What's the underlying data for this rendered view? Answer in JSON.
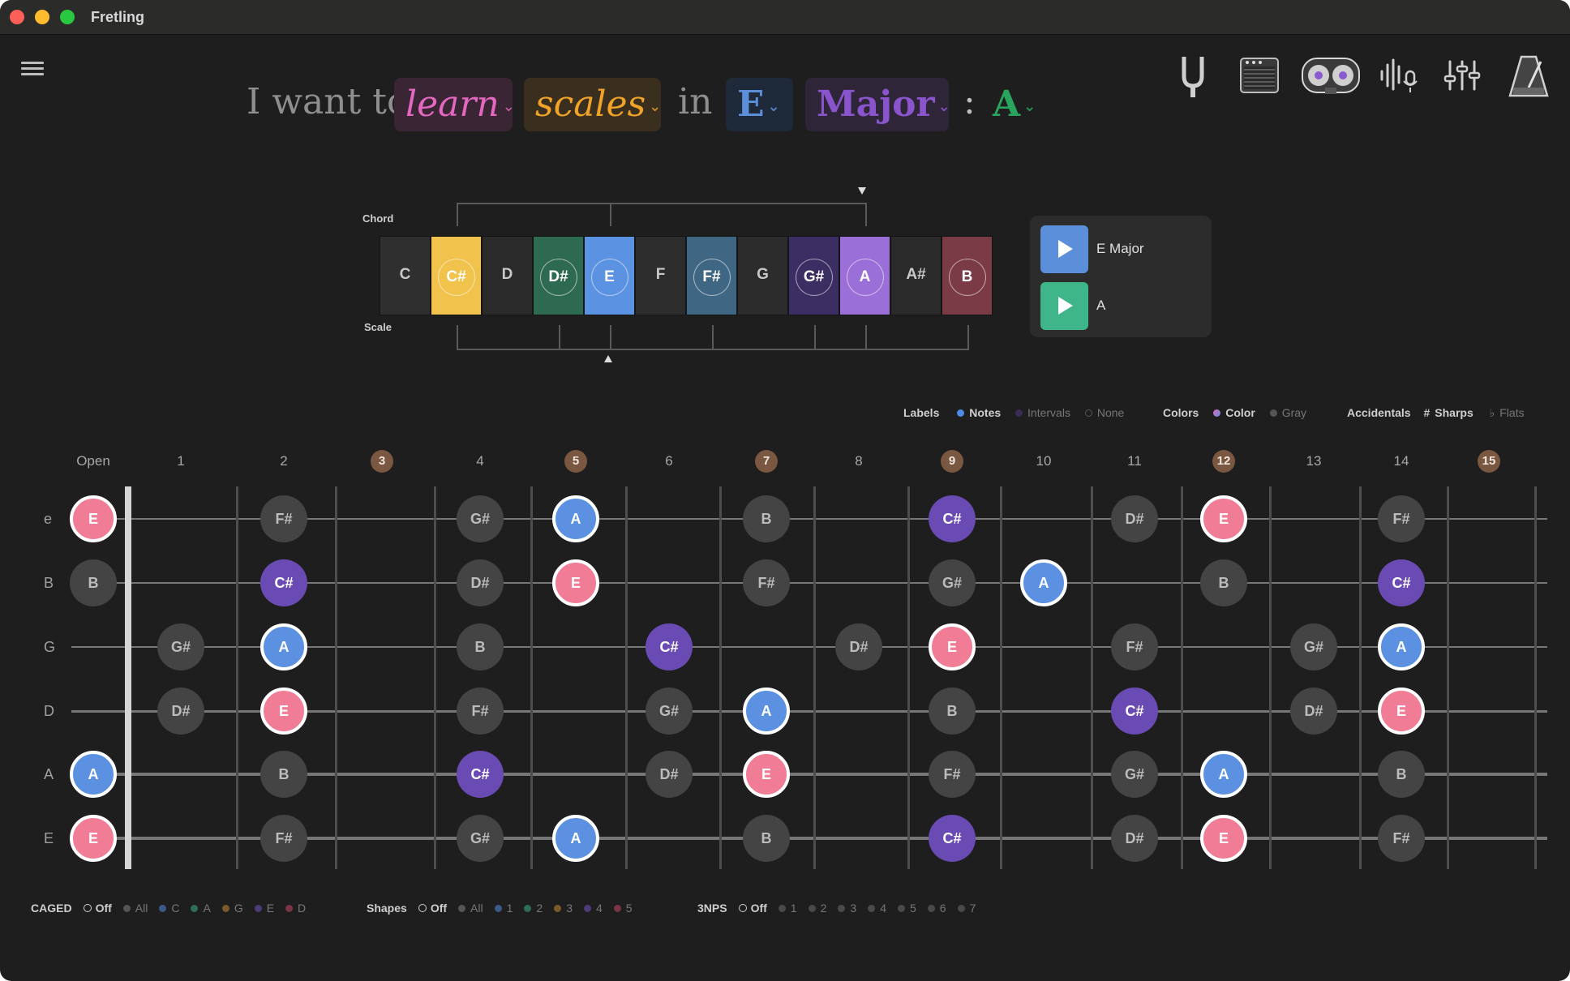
{
  "window": {
    "title": "Fretling"
  },
  "sentence": {
    "prefix": "I want to",
    "mode": "learn",
    "topic": "scales",
    "in": "in",
    "key": "E",
    "scale": "Major",
    "colon": ":",
    "chord": "A",
    "colors": {
      "mode": "#e468c2",
      "topic": "#f0a229",
      "key": "#5b8fd9",
      "scale": "#8a55cc",
      "chord": "#29a45e"
    }
  },
  "toolbar_icons": [
    "tuning-fork-icon",
    "amp-icon",
    "tape-recorder-icon",
    "microphone-icon",
    "mixer-sliders-icon",
    "metronome-icon"
  ],
  "keyboard": {
    "chord_label": "Chord",
    "scale_label": "Scale",
    "notes": [
      "C",
      "C#",
      "D",
      "D#",
      "E",
      "F",
      "F#",
      "G",
      "G#",
      "A",
      "A#",
      "B"
    ],
    "key_colors": [
      "#2f2f2f",
      "#f1c24c",
      "#2a2a2a",
      "#2e6a50",
      "#5b92e2",
      "#2d2d2d",
      "#3f6682",
      "#2c2c2c",
      "#3b2e63",
      "#9a6fd8",
      "#2a2a2a",
      "#7a3b47"
    ],
    "circle_colors": [
      "",
      "#f1c24c",
      "",
      "#2e6a50",
      "#5b92e2",
      "",
      "#3f6682",
      "",
      "#3b2e63",
      "#9a6fd8",
      "",
      "#7a3b47"
    ]
  },
  "audio": {
    "items": [
      {
        "label": "E Major",
        "color": "#5b8fd9"
      },
      {
        "label": "A",
        "color": "#3fb58a"
      }
    ]
  },
  "options": {
    "labels": {
      "title": "Labels",
      "notes": "Notes",
      "intervals": "Intervals",
      "none": "None"
    },
    "colors": {
      "title": "Colors",
      "color": "Color",
      "gray": "Gray"
    },
    "accidentals": {
      "title": "Accidentals",
      "sharps_symbol": "#",
      "sharps": "Sharps",
      "flats_symbol": "♭",
      "flats": "Flats"
    }
  },
  "fretboard": {
    "fret_labels": [
      "Open",
      "1",
      "2",
      "3",
      "4",
      "5",
      "6",
      "7",
      "8",
      "9",
      "10",
      "11",
      "12",
      "13",
      "14",
      "15"
    ],
    "marked_frets": [
      "3",
      "5",
      "7",
      "9",
      "12",
      "15"
    ],
    "strings": [
      "e",
      "B",
      "G",
      "D",
      "A",
      "E"
    ],
    "notes": [
      [
        {
          "fret": 0,
          "note": "E",
          "kind": "root"
        },
        {
          "fret": 2,
          "note": "F#",
          "kind": "scale"
        },
        {
          "fret": 4,
          "note": "G#",
          "kind": "scale"
        },
        {
          "fret": 5,
          "note": "A",
          "kind": "third"
        },
        {
          "fret": 7,
          "note": "B",
          "kind": "scale"
        },
        {
          "fret": 9,
          "note": "C#",
          "kind": "fifth"
        },
        {
          "fret": 11,
          "note": "D#",
          "kind": "scale"
        },
        {
          "fret": 12,
          "note": "E",
          "kind": "root"
        },
        {
          "fret": 14,
          "note": "F#",
          "kind": "scale"
        }
      ],
      [
        {
          "fret": 0,
          "note": "B",
          "kind": "scale"
        },
        {
          "fret": 2,
          "note": "C#",
          "kind": "fifth"
        },
        {
          "fret": 4,
          "note": "D#",
          "kind": "scale"
        },
        {
          "fret": 5,
          "note": "E",
          "kind": "root"
        },
        {
          "fret": 7,
          "note": "F#",
          "kind": "scale"
        },
        {
          "fret": 9,
          "note": "G#",
          "kind": "scale"
        },
        {
          "fret": 10,
          "note": "A",
          "kind": "third"
        },
        {
          "fret": 12,
          "note": "B",
          "kind": "scale"
        },
        {
          "fret": 14,
          "note": "C#",
          "kind": "fifth"
        }
      ],
      [
        {
          "fret": 1,
          "note": "G#",
          "kind": "scale"
        },
        {
          "fret": 2,
          "note": "A",
          "kind": "third"
        },
        {
          "fret": 4,
          "note": "B",
          "kind": "scale"
        },
        {
          "fret": 6,
          "note": "C#",
          "kind": "fifth"
        },
        {
          "fret": 8,
          "note": "D#",
          "kind": "scale"
        },
        {
          "fret": 9,
          "note": "E",
          "kind": "root"
        },
        {
          "fret": 11,
          "note": "F#",
          "kind": "scale"
        },
        {
          "fret": 13,
          "note": "G#",
          "kind": "scale"
        },
        {
          "fret": 14,
          "note": "A",
          "kind": "third"
        }
      ],
      [
        {
          "fret": 1,
          "note": "D#",
          "kind": "scale"
        },
        {
          "fret": 2,
          "note": "E",
          "kind": "root"
        },
        {
          "fret": 4,
          "note": "F#",
          "kind": "scale"
        },
        {
          "fret": 6,
          "note": "G#",
          "kind": "scale"
        },
        {
          "fret": 7,
          "note": "A",
          "kind": "third"
        },
        {
          "fret": 9,
          "note": "B",
          "kind": "scale"
        },
        {
          "fret": 11,
          "note": "C#",
          "kind": "fifth"
        },
        {
          "fret": 13,
          "note": "D#",
          "kind": "scale"
        },
        {
          "fret": 14,
          "note": "E",
          "kind": "root"
        }
      ],
      [
        {
          "fret": 0,
          "note": "A",
          "kind": "third"
        },
        {
          "fret": 2,
          "note": "B",
          "kind": "scale"
        },
        {
          "fret": 4,
          "note": "C#",
          "kind": "fifth"
        },
        {
          "fret": 6,
          "note": "D#",
          "kind": "scale"
        },
        {
          "fret": 7,
          "note": "E",
          "kind": "root"
        },
        {
          "fret": 9,
          "note": "F#",
          "kind": "scale"
        },
        {
          "fret": 11,
          "note": "G#",
          "kind": "scale"
        },
        {
          "fret": 12,
          "note": "A",
          "kind": "third"
        },
        {
          "fret": 14,
          "note": "B",
          "kind": "scale"
        }
      ],
      [
        {
          "fret": 0,
          "note": "E",
          "kind": "root"
        },
        {
          "fret": 2,
          "note": "F#",
          "kind": "scale"
        },
        {
          "fret": 4,
          "note": "G#",
          "kind": "scale"
        },
        {
          "fret": 5,
          "note": "A",
          "kind": "third"
        },
        {
          "fret": 7,
          "note": "B",
          "kind": "scale"
        },
        {
          "fret": 9,
          "note": "C#",
          "kind": "fifth"
        },
        {
          "fret": 11,
          "note": "D#",
          "kind": "scale"
        },
        {
          "fret": 12,
          "note": "E",
          "kind": "root"
        },
        {
          "fret": 14,
          "note": "F#",
          "kind": "scale"
        }
      ]
    ]
  },
  "bottom_bar": {
    "caged": {
      "title": "CAGED",
      "items": [
        "Off",
        "All",
        "C",
        "A",
        "G",
        "E",
        "D"
      ],
      "colors": [
        "",
        "#555",
        "#3b5a88",
        "#2f6e55",
        "#7a5a2a",
        "#4d3a78",
        "#7a3446"
      ]
    },
    "shapes": {
      "title": "Shapes",
      "items": [
        "Off",
        "All",
        "1",
        "2",
        "3",
        "4",
        "5"
      ],
      "colors": [
        "",
        "#555",
        "#3b5a88",
        "#2f6e55",
        "#7a5a2a",
        "#4d3a78",
        "#7a3446"
      ]
    },
    "threenps": {
      "title": "3NPS",
      "items": [
        "Off",
        "1",
        "2",
        "3",
        "4",
        "5",
        "6",
        "7"
      ],
      "colors": [
        "",
        "#4a4a4a",
        "#4a4a4a",
        "#4a4a4a",
        "#4a4a4a",
        "#4a4a4a",
        "#4a4a4a",
        "#4a4a4a"
      ]
    }
  }
}
